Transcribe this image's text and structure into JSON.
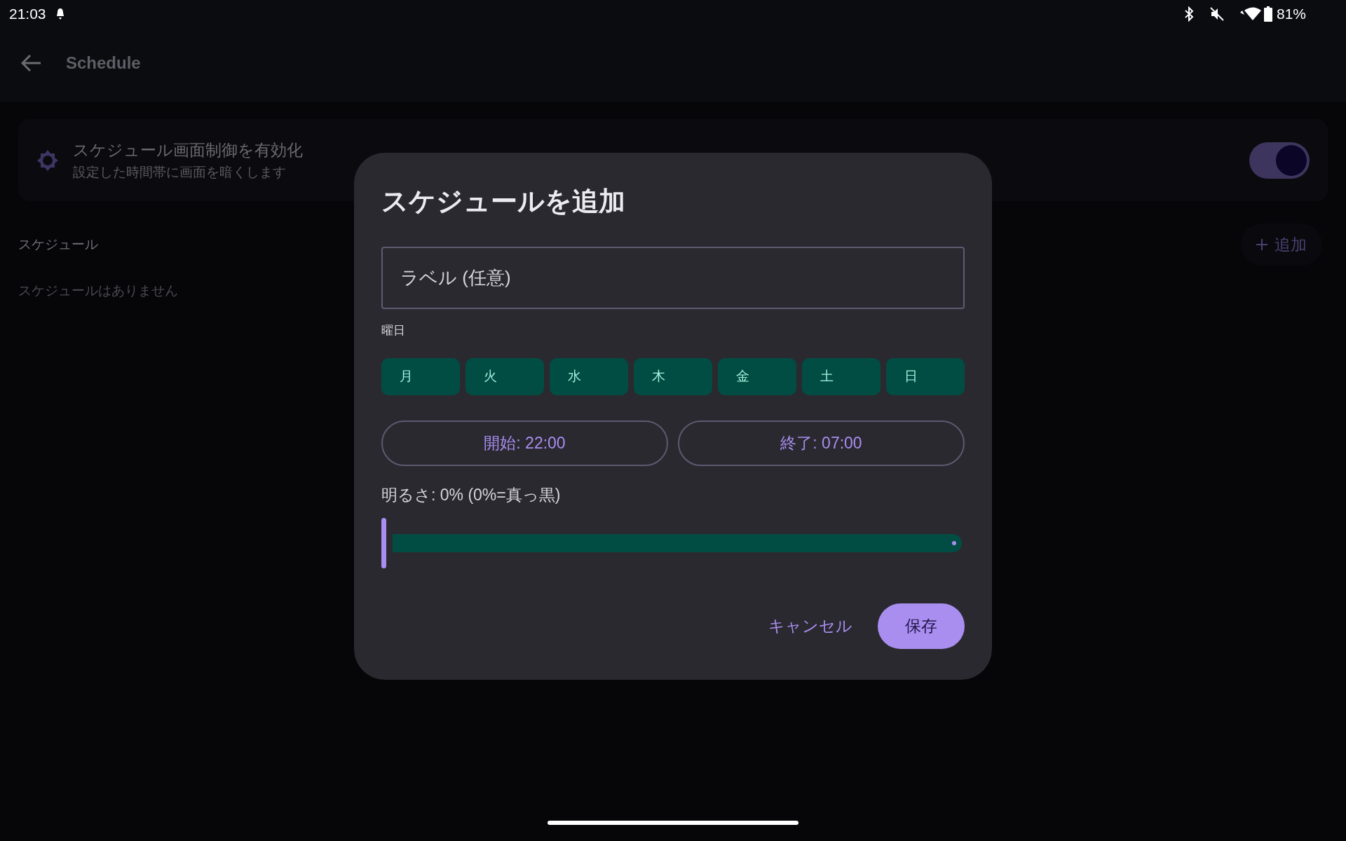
{
  "status_bar": {
    "time": "21:03",
    "battery": "81%"
  },
  "app_bar": {
    "title": "Schedule"
  },
  "enable_card": {
    "title": "スケジュール画面制御を有効化",
    "subtitle": "設定した時間帯に画面を暗くします",
    "on": true
  },
  "section": {
    "title": "スケジュール",
    "add_button": "追加",
    "empty_text": "スケジュールはありません"
  },
  "dialog": {
    "title": "スケジュールを追加",
    "label_field": {
      "placeholder": "ラベル (任意)"
    },
    "days_label": "曜日",
    "days": [
      "月",
      "火",
      "水",
      "木",
      "金",
      "土",
      "日"
    ],
    "start_button": "開始: 22:00",
    "end_button": "終了: 07:00",
    "brightness": {
      "label": "明るさ: 0% (0%=真っ黒)",
      "level": 0
    },
    "cancel_button": "キャンセル",
    "save_button": "保存"
  }
}
